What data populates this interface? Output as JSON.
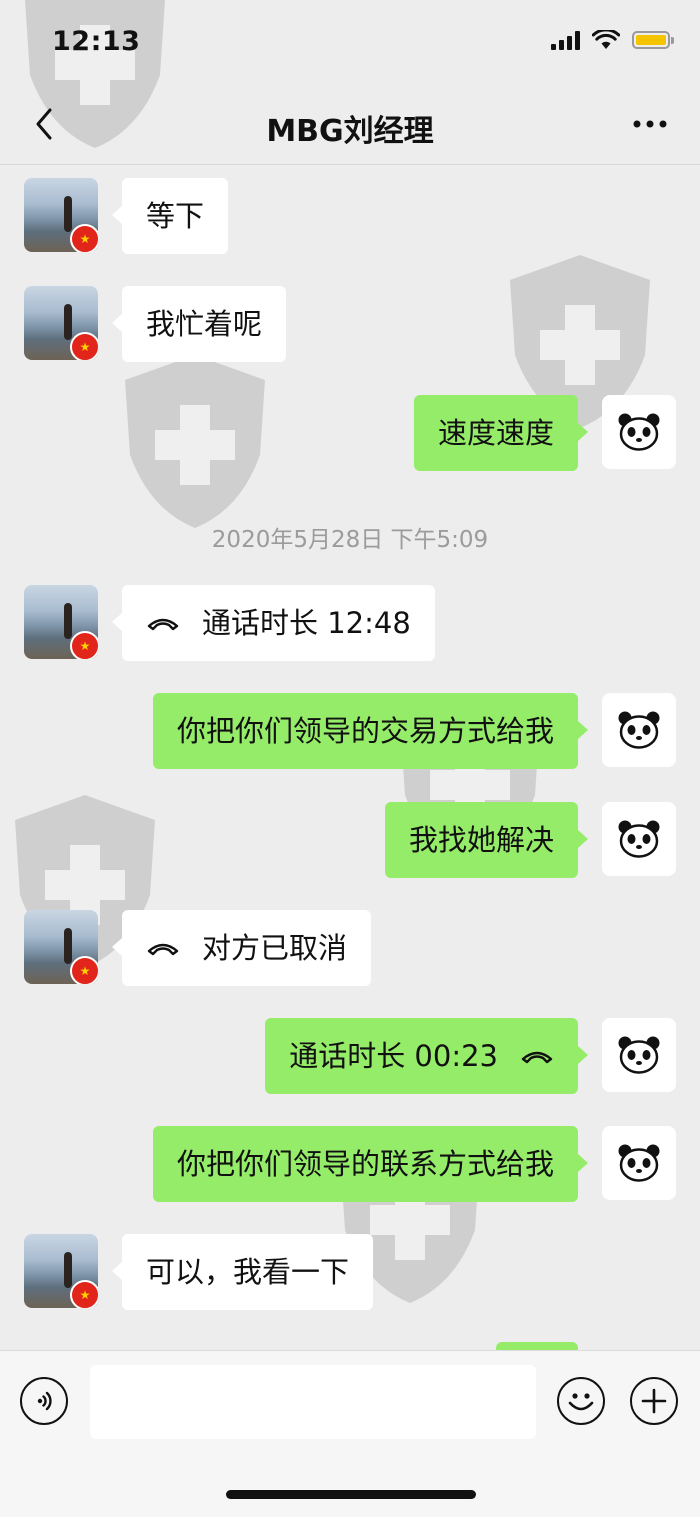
{
  "status": {
    "time": "12:13"
  },
  "header": {
    "title": "MBG刘经理"
  },
  "messages": [
    {
      "side": "left",
      "text": "等下"
    },
    {
      "side": "left",
      "text": "我忙着呢"
    },
    {
      "side": "right",
      "text": "速度速度"
    },
    {
      "side": "left",
      "text": "通话时长 12:48",
      "call": true
    },
    {
      "side": "right",
      "text": "你把你们领导的交易方式给我"
    },
    {
      "side": "right",
      "text": "我找她解决"
    },
    {
      "side": "left",
      "text": "对方已取消",
      "call": true
    },
    {
      "side": "right",
      "text": "通话时长 00:23",
      "call": true
    },
    {
      "side": "right",
      "text": "你把你们领导的联系方式给我"
    },
    {
      "side": "left",
      "text": "可以，我看一下"
    }
  ],
  "timestamp": "2020年5月28日 下午5:09",
  "icons": {
    "back": "chevron-left-icon",
    "more": "more-dots-icon",
    "voice": "voice-icon",
    "emoji": "emoji-icon",
    "plus": "plus-icon",
    "call": "phone-call-icon"
  },
  "colors": {
    "sent_bubble": "#95ec69",
    "received_bubble": "#ffffff",
    "background": "#ededed"
  }
}
